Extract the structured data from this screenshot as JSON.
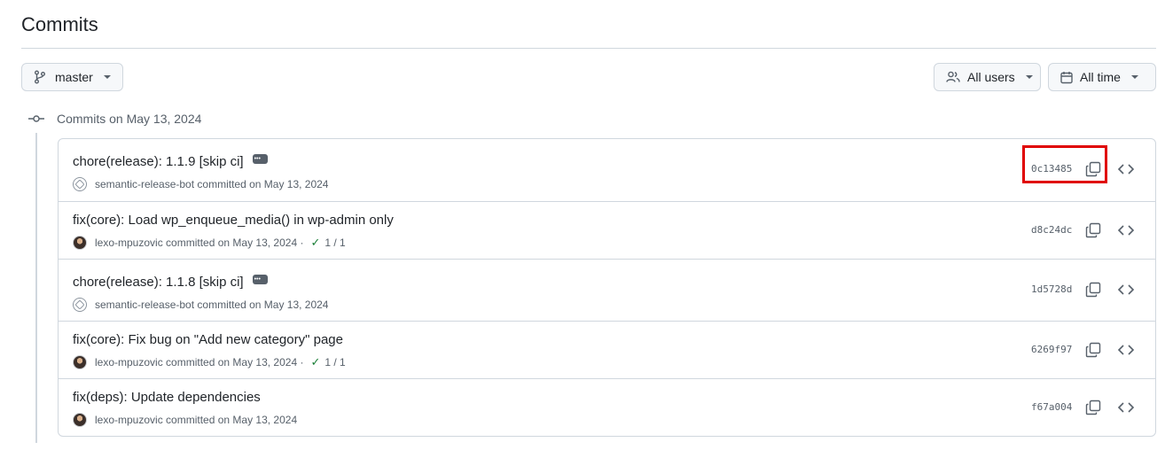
{
  "page": {
    "title": "Commits"
  },
  "filters": {
    "branch": {
      "label": "master",
      "icon": "git-branch-icon"
    },
    "users": {
      "label": "All users",
      "icon": "people-icon"
    },
    "time": {
      "label": "All time",
      "icon": "calendar-icon"
    }
  },
  "group": {
    "label": "Commits on May 13, 2024",
    "icon": "git-commit-icon"
  },
  "commits": [
    {
      "message": "chore(release): 1.1.9 [skip ci]",
      "has_more": true,
      "author": "semantic-release-bot",
      "avatar": "bot",
      "action": "committed on May 13, 2024",
      "checks": "",
      "sha": "0c13485"
    },
    {
      "message": "fix(core): Load wp_enqueue_media() in wp-admin only",
      "has_more": false,
      "author": "lexo-mpuzovic",
      "avatar": "user",
      "action": "committed on May 13, 2024",
      "checks": "1 / 1",
      "sha": "d8c24dc"
    },
    {
      "message": "chore(release): 1.1.8 [skip ci]",
      "has_more": true,
      "author": "semantic-release-bot",
      "avatar": "bot",
      "action": "committed on May 13, 2024",
      "checks": "",
      "sha": "1d5728d"
    },
    {
      "message": "fix(core): Fix bug on \"Add new category\" page",
      "has_more": false,
      "author": "lexo-mpuzovic",
      "avatar": "user",
      "action": "committed on May 13, 2024",
      "checks": "1 / 1",
      "sha": "6269f97"
    },
    {
      "message": "fix(deps): Update dependencies",
      "has_more": false,
      "author": "lexo-mpuzovic",
      "avatar": "user",
      "action": "committed on May 13, 2024",
      "checks": "",
      "sha": "f67a004"
    }
  ],
  "colors": {
    "highlight": "#e00000",
    "check": "#1a7f37",
    "border": "#d0d7de"
  }
}
